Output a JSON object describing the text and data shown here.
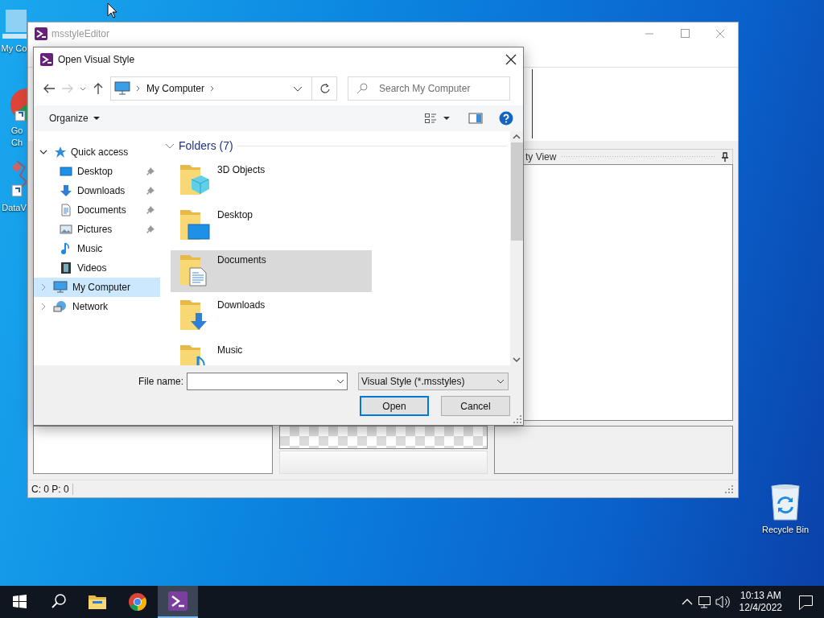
{
  "desktop": {
    "icons": [
      {
        "kind": "computer",
        "lines": [
          "My Co"
        ]
      },
      {
        "kind": "chrome",
        "lines": [
          "Go",
          "Ch"
        ]
      },
      {
        "kind": "dataviz",
        "lines": [
          "DataV"
        ]
      },
      {
        "kind": "recycle",
        "lines": [
          "Recycle Bin"
        ]
      }
    ]
  },
  "main_window": {
    "title": "msstyleEditor",
    "panel_title": "ty View",
    "status": "C: 0 P: 0"
  },
  "dialog": {
    "title": "Open Visual Style",
    "address": {
      "crumbs": [
        "My Computer"
      ]
    },
    "search": {
      "placeholder": "Search My Computer"
    },
    "organize": "Organize",
    "nav": [
      {
        "kind": "star",
        "label": "Quick access",
        "expanded": true,
        "selected": false,
        "children": [
          {
            "kind": "desktop",
            "label": "Desktop",
            "pinned": true
          },
          {
            "kind": "downloads",
            "label": "Downloads",
            "pinned": true
          },
          {
            "kind": "documents",
            "label": "Documents",
            "pinned": true
          },
          {
            "kind": "pictures",
            "label": "Pictures",
            "pinned": true
          },
          {
            "kind": "music",
            "label": "Music",
            "pinned": false
          },
          {
            "kind": "videos",
            "label": "Videos",
            "pinned": false
          }
        ]
      },
      {
        "kind": "computer",
        "label": "My Computer",
        "expanded": false,
        "selected": true
      },
      {
        "kind": "network",
        "label": "Network",
        "expanded": false,
        "selected": false
      }
    ],
    "group": {
      "label": "Folders (7)",
      "expanded": true
    },
    "folders": [
      {
        "kind": "objects3d",
        "name": "3D Objects",
        "selected": false
      },
      {
        "kind": "desktop",
        "name": "Desktop",
        "selected": false
      },
      {
        "kind": "documents",
        "name": "Documents",
        "selected": true
      },
      {
        "kind": "downloads",
        "name": "Downloads",
        "selected": false
      },
      {
        "kind": "music",
        "name": "Music",
        "selected": false
      }
    ],
    "file_name_label": "File name:",
    "filter": "Visual Style (*.msstyles)",
    "buttons": [
      {
        "label": "Open",
        "default": true
      },
      {
        "label": "Cancel",
        "default": false
      }
    ]
  },
  "taskbar": {
    "apps": [
      {
        "kind": "explorer",
        "active": false
      },
      {
        "kind": "chrome",
        "active": false
      },
      {
        "kind": "msstyle",
        "active": true
      }
    ],
    "time": "10:13 AM",
    "date": "12/4/2022"
  }
}
